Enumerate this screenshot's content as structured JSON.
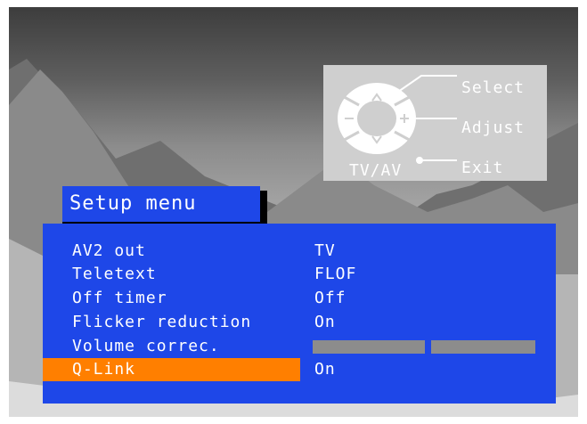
{
  "help": {
    "select_label": "Select",
    "adjust_label": "Adjust",
    "exit_label": "Exit",
    "tvav_label": "TV/AV"
  },
  "menu": {
    "title": "Setup menu",
    "items": [
      {
        "label": "AV2 out",
        "value": "TV"
      },
      {
        "label": "Teletext",
        "value": "FLOF"
      },
      {
        "label": "Off timer",
        "value": "Off"
      },
      {
        "label": "Flicker reduction",
        "value": "On"
      },
      {
        "label": "Volume correc.",
        "value": ""
      },
      {
        "label": "Q-Link",
        "value": "On"
      }
    ],
    "selected_index": 5
  },
  "colors": {
    "menu_blue": "#1e47e8",
    "highlight_orange": "#ff7f00",
    "help_panel_gray": "#cfcfcf",
    "text_white": "#ffffff"
  },
  "icons": [
    "remote-dpad-icon",
    "up-arrow-icon",
    "down-arrow-icon",
    "minus-icon",
    "plus-icon"
  ]
}
